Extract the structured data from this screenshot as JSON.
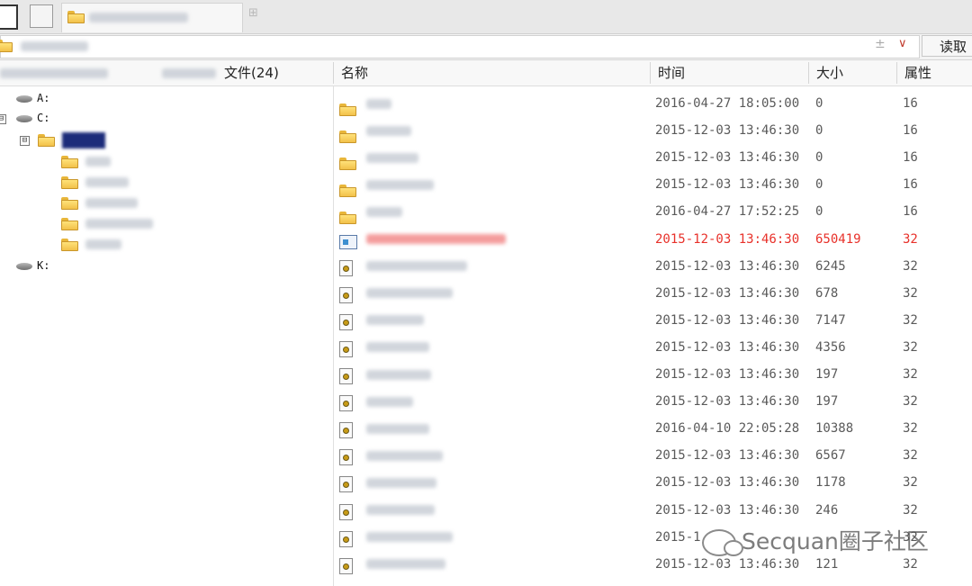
{
  "tabbar": {
    "add_tab": "⊞"
  },
  "addressbar": {
    "path_value": "",
    "pm_symbol": "±",
    "dropdown_symbol": "∨",
    "read_button": "读取"
  },
  "header": {
    "file_count": "文件(24)",
    "col_name": "名称",
    "col_time": "时间",
    "col_size": "大小",
    "col_attr": "属性"
  },
  "tree": {
    "drive_a": "A:",
    "drive_c": "C:",
    "drive_k": "K:",
    "expand_symbol": "⊟"
  },
  "files": [
    {
      "type": "folder",
      "time": "2016-04-27 18:05:00",
      "size": "0",
      "attr": "16",
      "highlight": false
    },
    {
      "type": "folder",
      "time": "2015-12-03 13:46:30",
      "size": "0",
      "attr": "16",
      "highlight": false
    },
    {
      "type": "folder",
      "time": "2015-12-03 13:46:30",
      "size": "0",
      "attr": "16",
      "highlight": false
    },
    {
      "type": "folder",
      "time": "2015-12-03 13:46:30",
      "size": "0",
      "attr": "16",
      "highlight": false
    },
    {
      "type": "folder",
      "time": "2016-04-27 17:52:25",
      "size": "0",
      "attr": "16",
      "highlight": false
    },
    {
      "type": "exe",
      "time": "2015-12-03 13:46:30",
      "size": "650419",
      "attr": "32",
      "highlight": true
    },
    {
      "type": "script",
      "time": "2015-12-03 13:46:30",
      "size": "6245",
      "attr": "32",
      "highlight": false
    },
    {
      "type": "script",
      "time": "2015-12-03 13:46:30",
      "size": "678",
      "attr": "32",
      "highlight": false
    },
    {
      "type": "script",
      "time": "2015-12-03 13:46:30",
      "size": "7147",
      "attr": "32",
      "highlight": false
    },
    {
      "type": "script",
      "time": "2015-12-03 13:46:30",
      "size": "4356",
      "attr": "32",
      "highlight": false
    },
    {
      "type": "script",
      "time": "2015-12-03 13:46:30",
      "size": "197",
      "attr": "32",
      "highlight": false
    },
    {
      "type": "script",
      "time": "2015-12-03 13:46:30",
      "size": "197",
      "attr": "32",
      "highlight": false
    },
    {
      "type": "script",
      "time": "2016-04-10 22:05:28",
      "size": "10388",
      "attr": "32",
      "highlight": false
    },
    {
      "type": "script",
      "time": "2015-12-03 13:46:30",
      "size": "6567",
      "attr": "32",
      "highlight": false
    },
    {
      "type": "script",
      "time": "2015-12-03 13:46:30",
      "size": "1178",
      "attr": "32",
      "highlight": false
    },
    {
      "type": "script",
      "time": "2015-12-03 13:46:30",
      "size": "246",
      "attr": "32",
      "highlight": false
    },
    {
      "type": "script",
      "time": "2015-1",
      "size": "",
      "attr": "32",
      "highlight": false
    },
    {
      "type": "script",
      "time": "2015-12-03 13:46:30",
      "size": "121",
      "attr": "32",
      "highlight": false
    }
  ],
  "watermark": {
    "text": "Secquan圈子社区"
  },
  "colors": {
    "highlight": "#e8312a",
    "text": "#5a5a5a",
    "selection": "#1c2c7a"
  }
}
